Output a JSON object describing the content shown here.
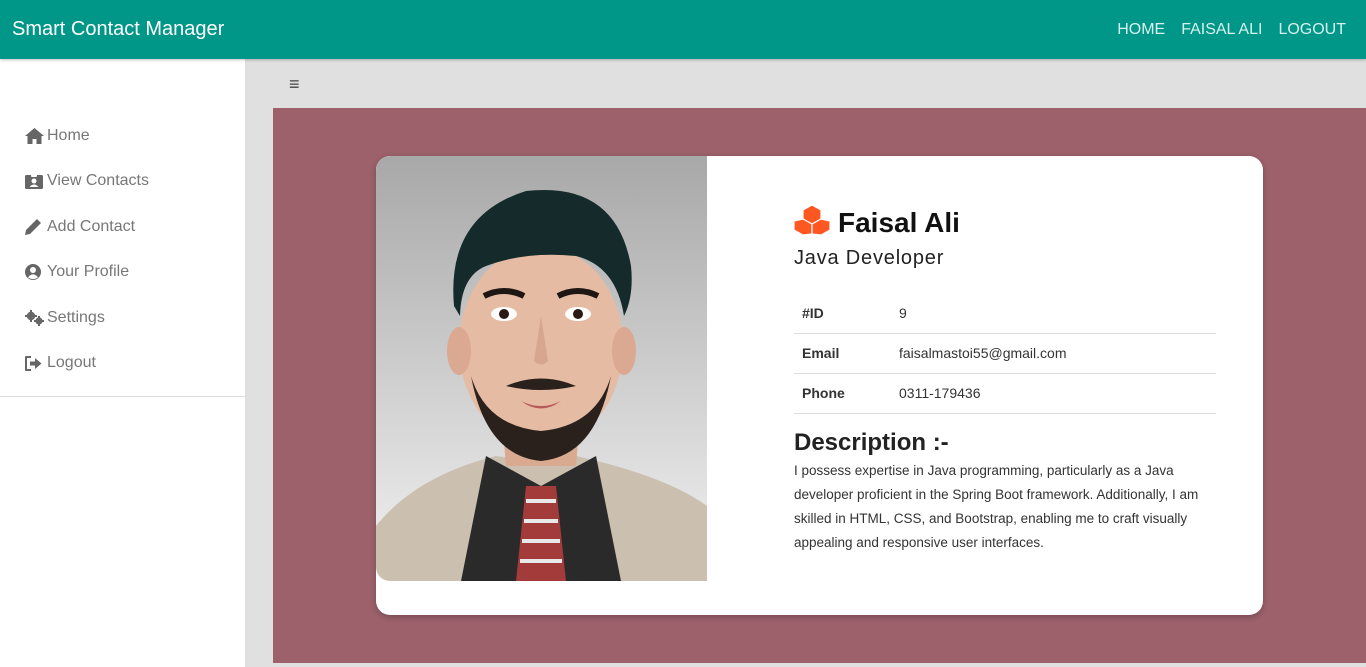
{
  "app": {
    "brand": "Smart Contact Manager",
    "colors": {
      "navbar": "#009688",
      "content_bg": "#9c616b",
      "logo_orange": "#ff5722"
    }
  },
  "nav": {
    "home": "HOME",
    "user": "FAISAL ALI",
    "logout": "LOGOUT"
  },
  "sidebar": {
    "items": [
      {
        "label": "Home",
        "icon": "home-icon"
      },
      {
        "label": "View Contacts",
        "icon": "contact-card-icon"
      },
      {
        "label": "Add Contact",
        "icon": "pencil-icon"
      },
      {
        "label": "Your Profile",
        "icon": "user-circle-icon"
      },
      {
        "label": "Settings",
        "icon": "gears-icon"
      },
      {
        "label": "Logout",
        "icon": "sign-out-icon"
      }
    ]
  },
  "toolbar": {
    "menu_icon": "hamburger-icon",
    "menu_glyph": "≡"
  },
  "profile": {
    "name": "Faisal Ali",
    "title": "Java Developer",
    "details": [
      {
        "key": "#ID",
        "value": "9"
      },
      {
        "key": "Email",
        "value": "faisalmastoi55@gmail.com"
      },
      {
        "key": "Phone",
        "value": "0311-179436"
      }
    ],
    "description_title": "Description :-",
    "description": "I possess expertise in Java programming, particularly as a Java developer proficient in the Spring Boot framework. Additionally, I am skilled in HTML, CSS, and Bootstrap, enabling me to craft visually appealing and responsive user interfaces."
  }
}
